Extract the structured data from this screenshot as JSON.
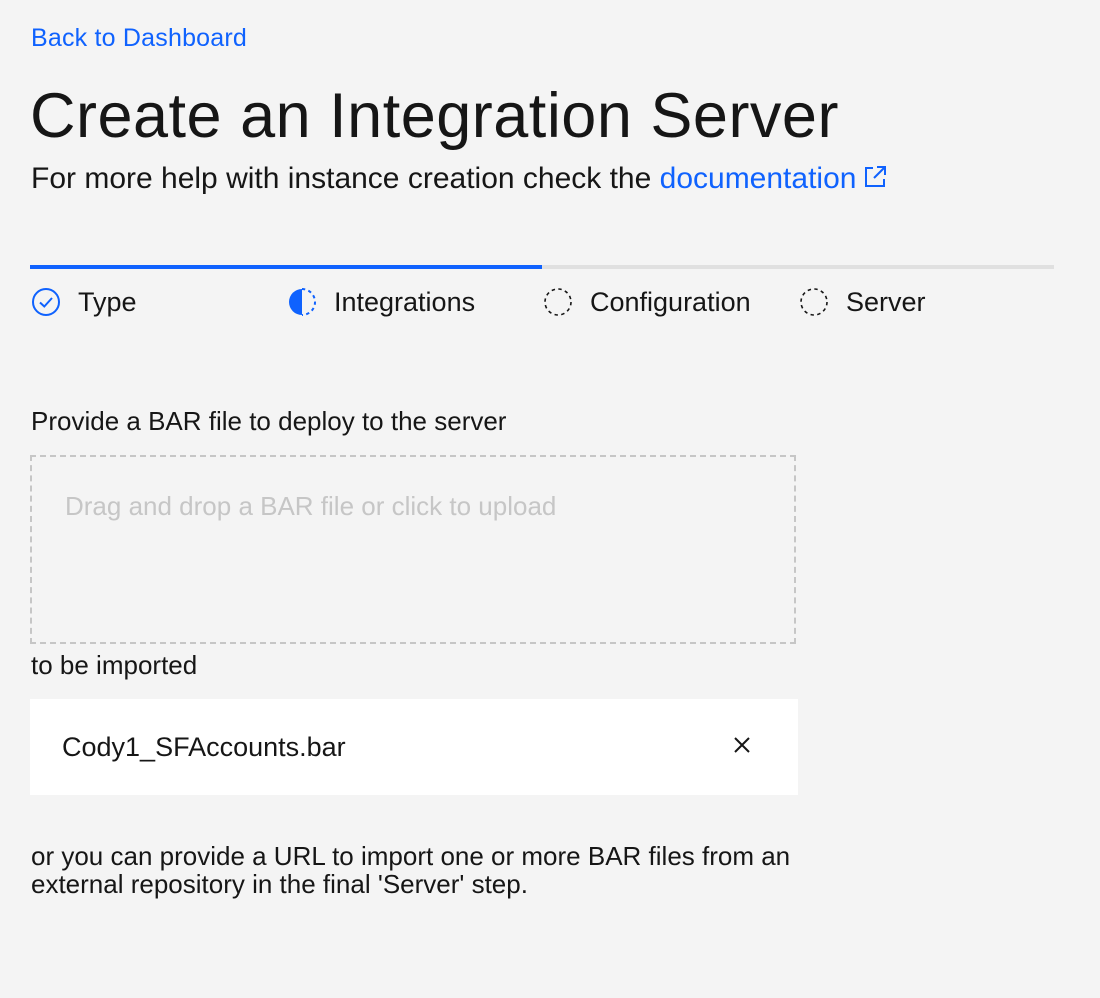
{
  "nav": {
    "back_label": "Back to Dashboard"
  },
  "header": {
    "title": "Create an Integration Server",
    "subtitle_text": "For more help with instance creation check the ",
    "doc_link_label": "documentation",
    "doc_link_icon": "external-link-icon"
  },
  "progress": {
    "steps": [
      {
        "label": "Type",
        "state": "complete",
        "icon": "checkmark-circle-icon"
      },
      {
        "label": "Integrations",
        "state": "current",
        "icon": "half-circle-icon"
      },
      {
        "label": "Configuration",
        "state": "incomplete",
        "icon": "dashed-circle-icon"
      },
      {
        "label": "Server",
        "state": "incomplete",
        "icon": "dashed-circle-icon"
      }
    ]
  },
  "upload": {
    "prompt": "Provide a BAR file to deploy to the server",
    "dropzone_text": "Drag and drop a BAR file or click to upload",
    "imported_label": "to be imported",
    "files": [
      {
        "name": "Cody1_SFAccounts.bar",
        "remove_icon": "close-icon"
      }
    ],
    "footer_note": "or you can provide a URL to import one or more BAR files from an external repository in the final 'Server' step."
  },
  "colors": {
    "accent": "#0f62fe",
    "background": "#f4f4f4",
    "text": "#161616",
    "muted": "#c6c6c6",
    "track": "#e0e0e0"
  }
}
